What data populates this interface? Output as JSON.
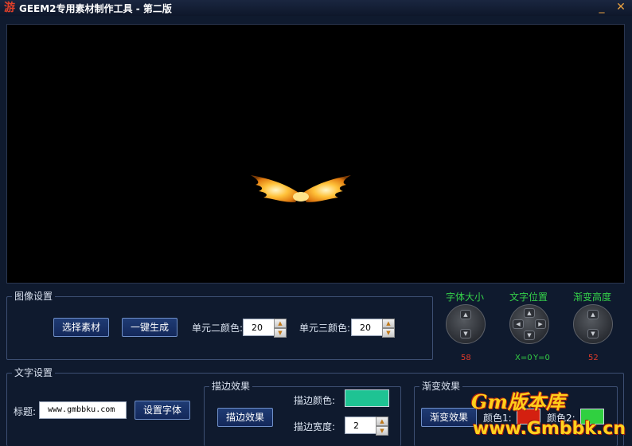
{
  "app": {
    "title": "GEEM2专用素材制作工具 - 第二版",
    "minimize_glyph": "_",
    "close_glyph": "✕"
  },
  "image_settings": {
    "legend": "图像设置",
    "select_button": "选择素材",
    "generate_button": "一键生成",
    "unit2_label": "单元二颜色:",
    "unit2_value": "20",
    "unit3_label": "单元三颜色:",
    "unit3_value": "20"
  },
  "dials": {
    "font_size": {
      "label": "字体大小",
      "value": "58"
    },
    "text_position": {
      "label": "文字位置",
      "x_label": "X=0",
      "y_label": "Y=0"
    },
    "gradient_height": {
      "label": "渐变高度",
      "value": "52"
    }
  },
  "text_settings": {
    "legend": "文字设置",
    "title_label": "标题:",
    "title_value": "www.gmbbku.com",
    "font_button": "设置字体"
  },
  "stroke": {
    "legend": "描边效果",
    "button": "描边效果",
    "color_label": "描边颜色:",
    "color": "#1ec393",
    "width_label": "描边宽度:",
    "width_value": "2"
  },
  "gradient": {
    "legend": "渐变效果",
    "button": "渐变效果",
    "color1_label": "颜色1:",
    "color1": "#d42010",
    "color2_label": "颜色2:",
    "color2": "#30d040"
  },
  "watermark": {
    "brand": "Gm版本库",
    "url": "www.Gmbbk.cn"
  }
}
